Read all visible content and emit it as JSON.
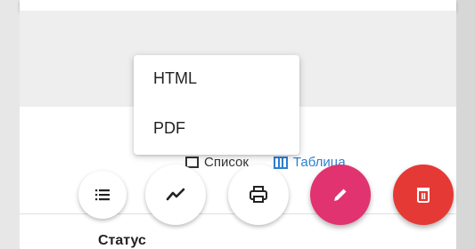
{
  "menu": {
    "items": [
      "HTML",
      "PDF"
    ]
  },
  "view_toggle": {
    "list_label": "Список",
    "table_label": "Таблица"
  },
  "table": {
    "status_header": "Статус"
  },
  "fabs": [
    {
      "name": "list-fab",
      "icon": "list-icon"
    },
    {
      "name": "chart-fab",
      "icon": "trend-icon"
    },
    {
      "name": "print-fab",
      "icon": "print-icon"
    },
    {
      "name": "edit-fab",
      "icon": "pencil-icon",
      "color": "#e0336f"
    },
    {
      "name": "delete-fab",
      "icon": "trash-icon",
      "color": "#e53935"
    }
  ],
  "colors": {
    "accent_blue": "#2f7fd2",
    "edit_pink": "#e0336f",
    "delete_red": "#e53935"
  }
}
